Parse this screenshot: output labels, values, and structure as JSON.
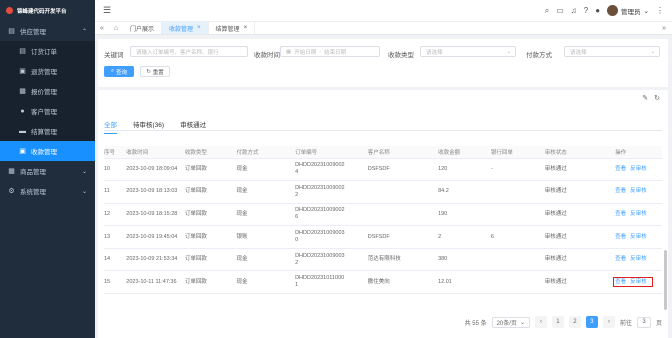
{
  "brand": "锦峰建代码开发平台",
  "sidebar": [
    {
      "label": "供应管理",
      "icon": "cart-icon",
      "chev": "⌃",
      "sub": false,
      "active": false
    },
    {
      "label": "订货订单",
      "icon": "doc-icon",
      "sub": true,
      "active": false
    },
    {
      "label": "退货管理",
      "icon": "return-icon",
      "sub": true,
      "active": false
    },
    {
      "label": "报价管理",
      "icon": "quote-icon",
      "sub": true,
      "active": false
    },
    {
      "label": "客户管理",
      "icon": "user-icon",
      "sub": true,
      "active": false
    },
    {
      "label": "结算管理",
      "icon": "truck-icon",
      "sub": true,
      "active": false
    },
    {
      "label": "收款管理",
      "icon": "wallet-icon",
      "sub": true,
      "active": true
    },
    {
      "label": "商品管理",
      "icon": "grid-icon",
      "chev": "⌄",
      "sub": false,
      "active": false
    },
    {
      "label": "系统管理",
      "icon": "gear-icon",
      "chev": "⌄",
      "sub": false,
      "active": false
    }
  ],
  "header": {
    "user": "管理员"
  },
  "tabs": [
    {
      "label": "门户展示",
      "closable": false,
      "active": false
    },
    {
      "label": "收款管理",
      "closable": true,
      "active": true
    },
    {
      "label": "结算管理",
      "closable": true,
      "active": false
    }
  ],
  "filters": {
    "keyword_label": "关键词",
    "keyword_ph": "请输入订单编号、客户名称、银行",
    "time_label": "收款时间",
    "start_ph": "开始日期",
    "sep": "-",
    "end_ph": "结束日期",
    "type_label": "收款类型",
    "type_ph": "请选择",
    "pay_label": "付款方式",
    "pay_ph": "请选择",
    "query": "查询",
    "reset": "重置"
  },
  "status_tabs": [
    "全部",
    "待审核(36)",
    "审核通过"
  ],
  "columns": [
    "序号",
    "收款时间",
    "收款类型",
    "付款方式",
    "订单编号",
    "客户名称",
    "收款金额",
    "银行回单",
    "审核状态",
    "操作"
  ],
  "rows": [
    {
      "no": "10",
      "time": "2023-10-09 18:09:04",
      "type": "订单回款",
      "pay": "现金",
      "order1": "DHDD20231009002",
      "order2": "4",
      "cust": "DSFSDF",
      "amt": "120",
      "bank": "-",
      "status": "审核通过"
    },
    {
      "no": "11",
      "time": "2023-10-09 18:13:03",
      "type": "订单回款",
      "pay": "现金",
      "order1": "DHDD20231009002",
      "order2": "2",
      "cust": "",
      "amt": "84.2",
      "bank": "",
      "status": "审核通过"
    },
    {
      "no": "12",
      "time": "2023-10-09 18:15:28",
      "type": "订单回款",
      "pay": "现金",
      "order1": "DHDD20231009002",
      "order2": "6",
      "cust": "",
      "amt": "190",
      "bank": "",
      "status": "审核通过"
    },
    {
      "no": "13",
      "time": "2023-10-09 19:45:04",
      "type": "订单回款",
      "pay": "银账",
      "order1": "DHDD20231009003",
      "order2": "0",
      "cust": "DSFSDF",
      "amt": "2",
      "bank": "6",
      "status": "审核通过"
    },
    {
      "no": "14",
      "time": "2023-10-09 21:53:34",
      "type": "订单回款",
      "pay": "现金",
      "order1": "DHDD20231009003",
      "order2": "2",
      "cust": "范达有限科技",
      "amt": "380",
      "bank": "",
      "status": "审核通过"
    },
    {
      "no": "15",
      "time": "2023-10-11 11:47:36",
      "type": "订单回款",
      "pay": "现金",
      "order1": "DHDD20231011000",
      "order2": "1",
      "cust": "撒住美向",
      "amt": "12.01",
      "bank": "",
      "status": "审核通过"
    }
  ],
  "ops": {
    "view": "查看",
    "unaudit": "反审核"
  },
  "pager": {
    "total": "共 55 条",
    "size": "20条/页",
    "pages": [
      "1",
      "2",
      "3"
    ],
    "current": "3",
    "goto": "前往",
    "goto_val": "3",
    "page_unit": "页"
  }
}
